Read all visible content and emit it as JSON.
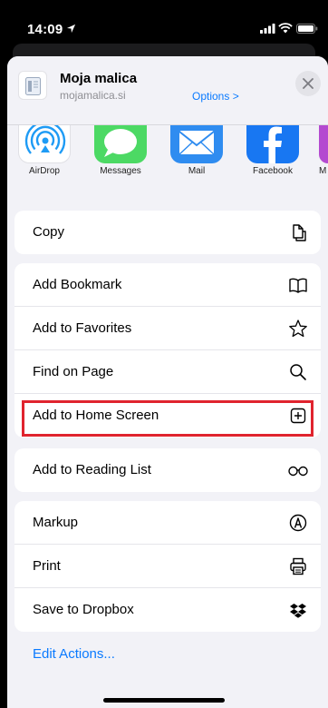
{
  "status": {
    "time": "14:09"
  },
  "header": {
    "title": "Moja malica",
    "url": "mojamalica.si",
    "options_label": "Options >"
  },
  "apps": [
    {
      "label": "AirDrop",
      "icon": "airdrop-icon"
    },
    {
      "label": "Messages",
      "icon": "messages-icon"
    },
    {
      "label": "Mail",
      "icon": "mail-icon"
    },
    {
      "label": "Facebook",
      "icon": "facebook-icon"
    },
    {
      "label": "M",
      "icon": "app-icon-partial"
    }
  ],
  "actions": {
    "group1": [
      {
        "label": "Copy",
        "icon": "copy-icon"
      }
    ],
    "group2": [
      {
        "label": "Add Bookmark",
        "icon": "book-icon"
      },
      {
        "label": "Add to Favorites",
        "icon": "star-icon"
      },
      {
        "label": "Find on Page",
        "icon": "search-icon"
      },
      {
        "label": "Add to Home Screen",
        "icon": "plus-square-icon"
      }
    ],
    "group3": [
      {
        "label": "Add to Reading List",
        "icon": "glasses-icon"
      }
    ],
    "group4": [
      {
        "label": "Markup",
        "icon": "markup-icon"
      },
      {
        "label": "Print",
        "icon": "printer-icon"
      },
      {
        "label": "Save to Dropbox",
        "icon": "dropbox-icon"
      }
    ]
  },
  "edit_actions_label": "Edit Actions...",
  "colors": {
    "accent": "#0a7aff",
    "highlight": "#e0242e",
    "sheet_bg": "#f2f2f7"
  }
}
